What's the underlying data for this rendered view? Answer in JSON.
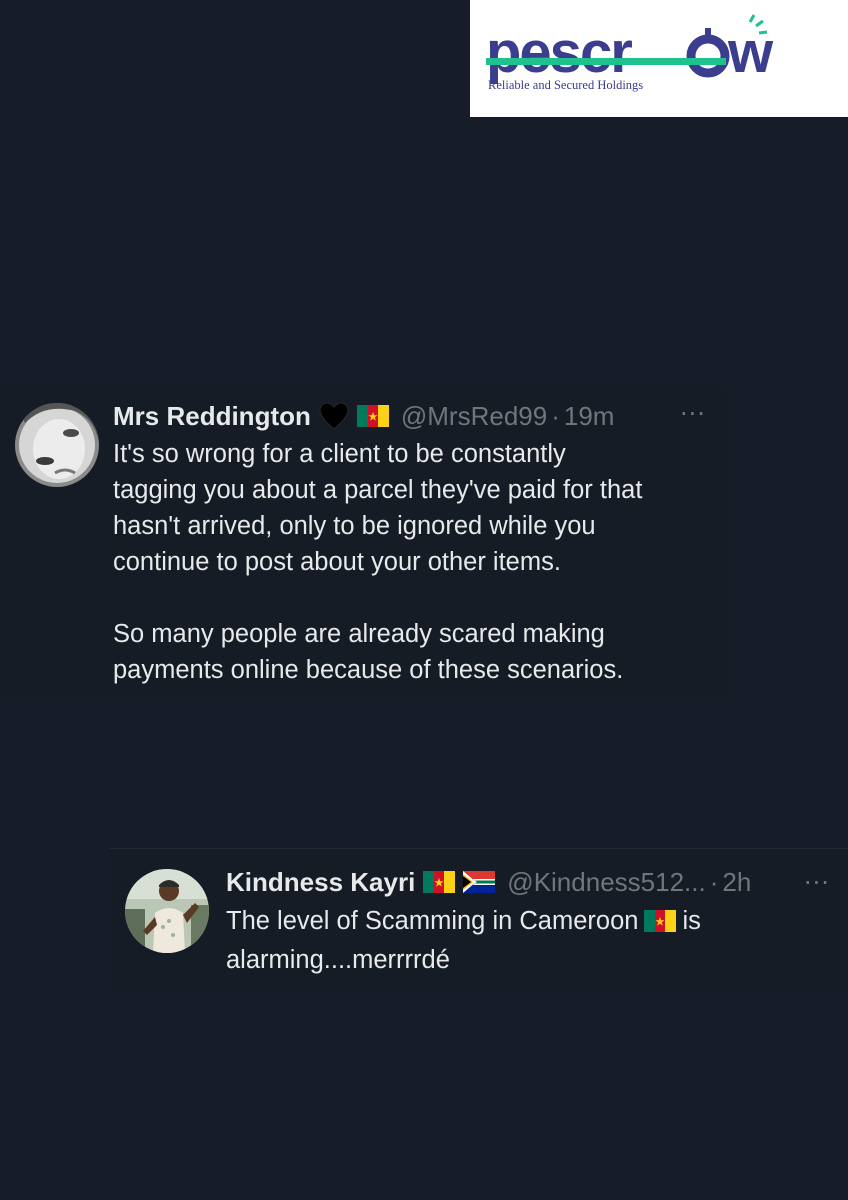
{
  "logo": {
    "brand": "Pescrow",
    "tagline": "Reliable and Secured Holdings",
    "colors": {
      "primary": "#3b3d8f",
      "accent": "#1ec28c"
    }
  },
  "tweets": [
    {
      "display_name": "Mrs Reddington",
      "badges": [
        "black-heart-icon",
        "cameroon-flag-icon"
      ],
      "handle": "@MrsRed99",
      "separator": "·",
      "time": "19m",
      "more": "···",
      "body_lines": [
        "It's so wrong  for a client to be constantly",
        "tagging you about a parcel they've paid for that",
        "hasn't arrived, only to be ignored while you",
        "continue to post about your other items."
      ],
      "body_lines_2": [
        "So many people are already scared making",
        "payments online because of these scenarios."
      ]
    },
    {
      "display_name": "Kindness Kayri",
      "badges": [
        "cameroon-flag-icon",
        "south-africa-flag-icon"
      ],
      "handle": "@Kindness512...",
      "separator": "·",
      "time": "2h",
      "more": "···",
      "body_line_1_before": "The level of Scamming  in Cameroon",
      "body_line_1_after": "is",
      "body_line_2": "alarming....merrrrdé"
    }
  ],
  "colors": {
    "background": "#161d28",
    "text": "#e7e9ea",
    "secondary_text": "#71767b"
  }
}
